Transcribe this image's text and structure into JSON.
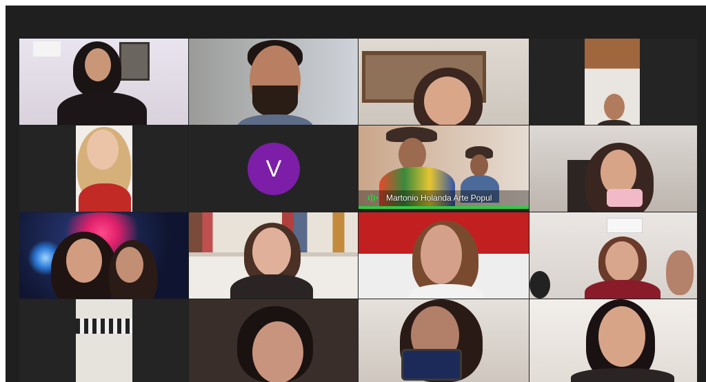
{
  "meeting": {
    "tiles": [
      {
        "id": "r1c1",
        "type": "video"
      },
      {
        "id": "r1c2",
        "type": "video"
      },
      {
        "id": "r1c3",
        "type": "video"
      },
      {
        "id": "r1c4",
        "type": "video"
      },
      {
        "id": "r2c1",
        "type": "video"
      },
      {
        "id": "r2c2",
        "type": "avatar",
        "avatar_letter": "V",
        "avatar_color": "#7c1ea7"
      },
      {
        "id": "r2c3",
        "type": "video",
        "name": "Martonio Holanda Arte Popul",
        "active_speaker": true,
        "speaker_color": "#2ecc40",
        "icon": "audio-wave-icon"
      },
      {
        "id": "r2c4",
        "type": "video"
      },
      {
        "id": "r3c1",
        "type": "video"
      },
      {
        "id": "r3c2",
        "type": "video"
      },
      {
        "id": "r3c3",
        "type": "video"
      },
      {
        "id": "r3c4",
        "type": "video"
      },
      {
        "id": "r4c1",
        "type": "video"
      },
      {
        "id": "r4c2",
        "type": "video"
      },
      {
        "id": "r4c3",
        "type": "video"
      },
      {
        "id": "r4c4",
        "type": "video"
      }
    ]
  },
  "colors": {
    "background": "#1f1f1f",
    "avatar": "#7c1ea7",
    "active_speaker": "#2ecc40"
  }
}
